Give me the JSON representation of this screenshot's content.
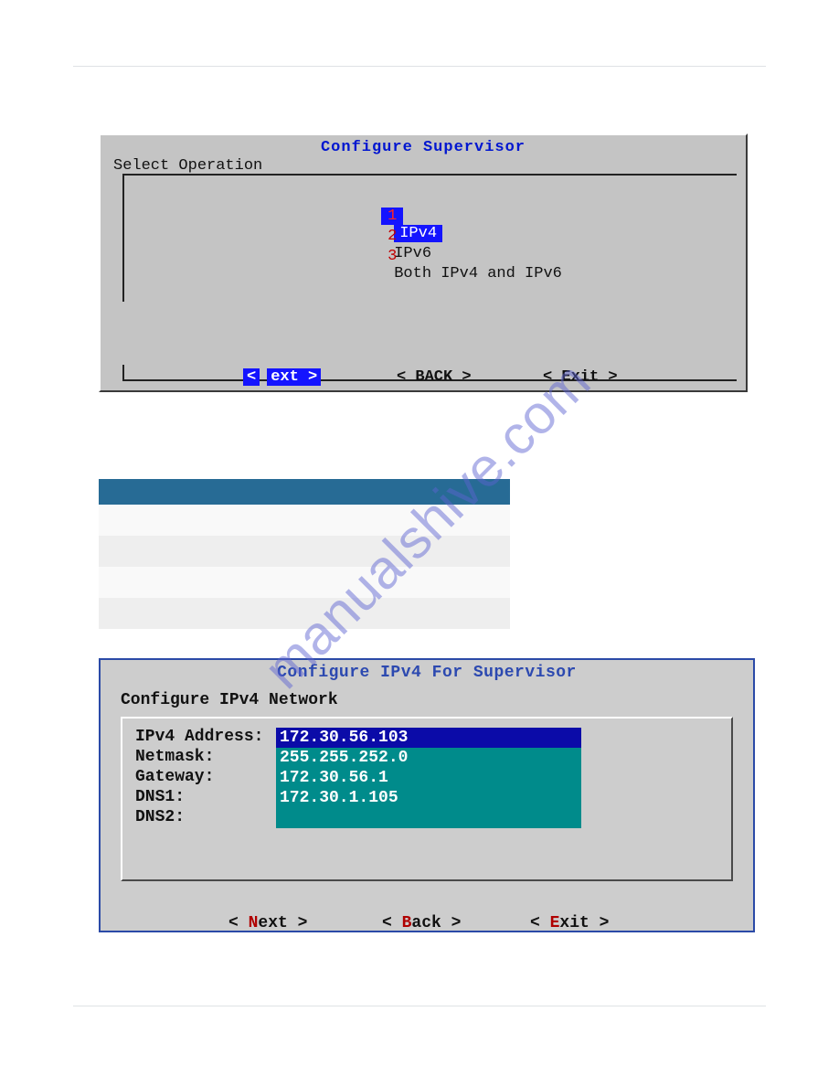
{
  "watermark": "manualshive.com",
  "shot1": {
    "title": "Configure Supervisor",
    "selectOperation": "Select Operation",
    "options": [
      {
        "num": "1",
        "label": "IPv4",
        "selected": true
      },
      {
        "num": "2",
        "label": "IPv6",
        "selected": false
      },
      {
        "num": "3",
        "label": "Both IPv4 and IPv6",
        "selected": false
      }
    ],
    "buttons": {
      "next_left": "<",
      "next_right": "ext >",
      "back": "< BACK >",
      "exit": "< Exit >"
    }
  },
  "shot2": {
    "title": "Configure IPv4  For Supervisor",
    "subtitle": "Configure IPv4 Network",
    "fields": [
      {
        "label": "IPv4 Address:",
        "value": "172.30.56.103",
        "selected": true
      },
      {
        "label": "Netmask:",
        "value": "255.255.252.0",
        "selected": false
      },
      {
        "label": "Gateway:",
        "value": "172.30.56.1",
        "selected": false
      },
      {
        "label": "DNS1:",
        "value": "172.30.1.105",
        "selected": false
      },
      {
        "label": "DNS2:",
        "value": "",
        "selected": false
      }
    ],
    "buttons": [
      {
        "pre": "< ",
        "hot": "N",
        "rest": "ext >"
      },
      {
        "pre": "< ",
        "hot": "B",
        "rest": "ack >"
      },
      {
        "pre": "< ",
        "hot": "E",
        "rest": "xit >"
      }
    ]
  }
}
